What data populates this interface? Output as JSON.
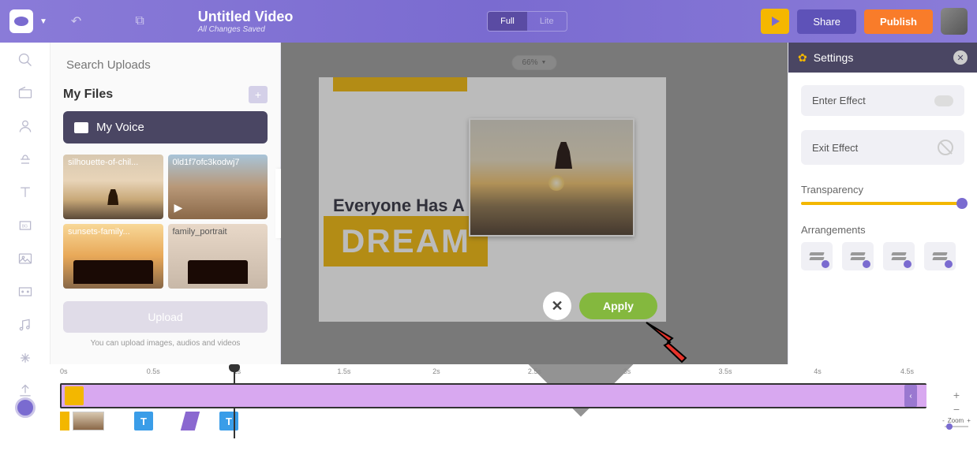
{
  "header": {
    "title": "Untitled Video",
    "subtitle": "All Changes Saved",
    "mode_full": "Full",
    "mode_lite": "Lite",
    "share": "Share",
    "publish": "Publish"
  },
  "uploads": {
    "search_placeholder": "Search Uploads",
    "my_files": "My Files",
    "folder": "My Voice",
    "thumbs": [
      "silhouette-of-chil...",
      "0ld1f7ofc3kodwj7",
      "sunsets-family...",
      "family_portrait"
    ],
    "upload_btn": "Upload",
    "note": "You can upload images, audios and videos"
  },
  "canvas": {
    "zoom": "66%",
    "text1": "Everyone Has A",
    "dream": "DREAM",
    "apply": "Apply"
  },
  "settings": {
    "title": "Settings",
    "enter": "Enter Effect",
    "exit": "Exit Effect",
    "transparency": "Transparency",
    "arrangements": "Arrangements"
  },
  "timeline": {
    "ticks": [
      "0s",
      "0.5s",
      "1s",
      "1.5s",
      "2s",
      "2.5s",
      "3s",
      "3.5s",
      "4s",
      "4.5s"
    ],
    "t_label": "T",
    "zoom": "Zoom"
  }
}
